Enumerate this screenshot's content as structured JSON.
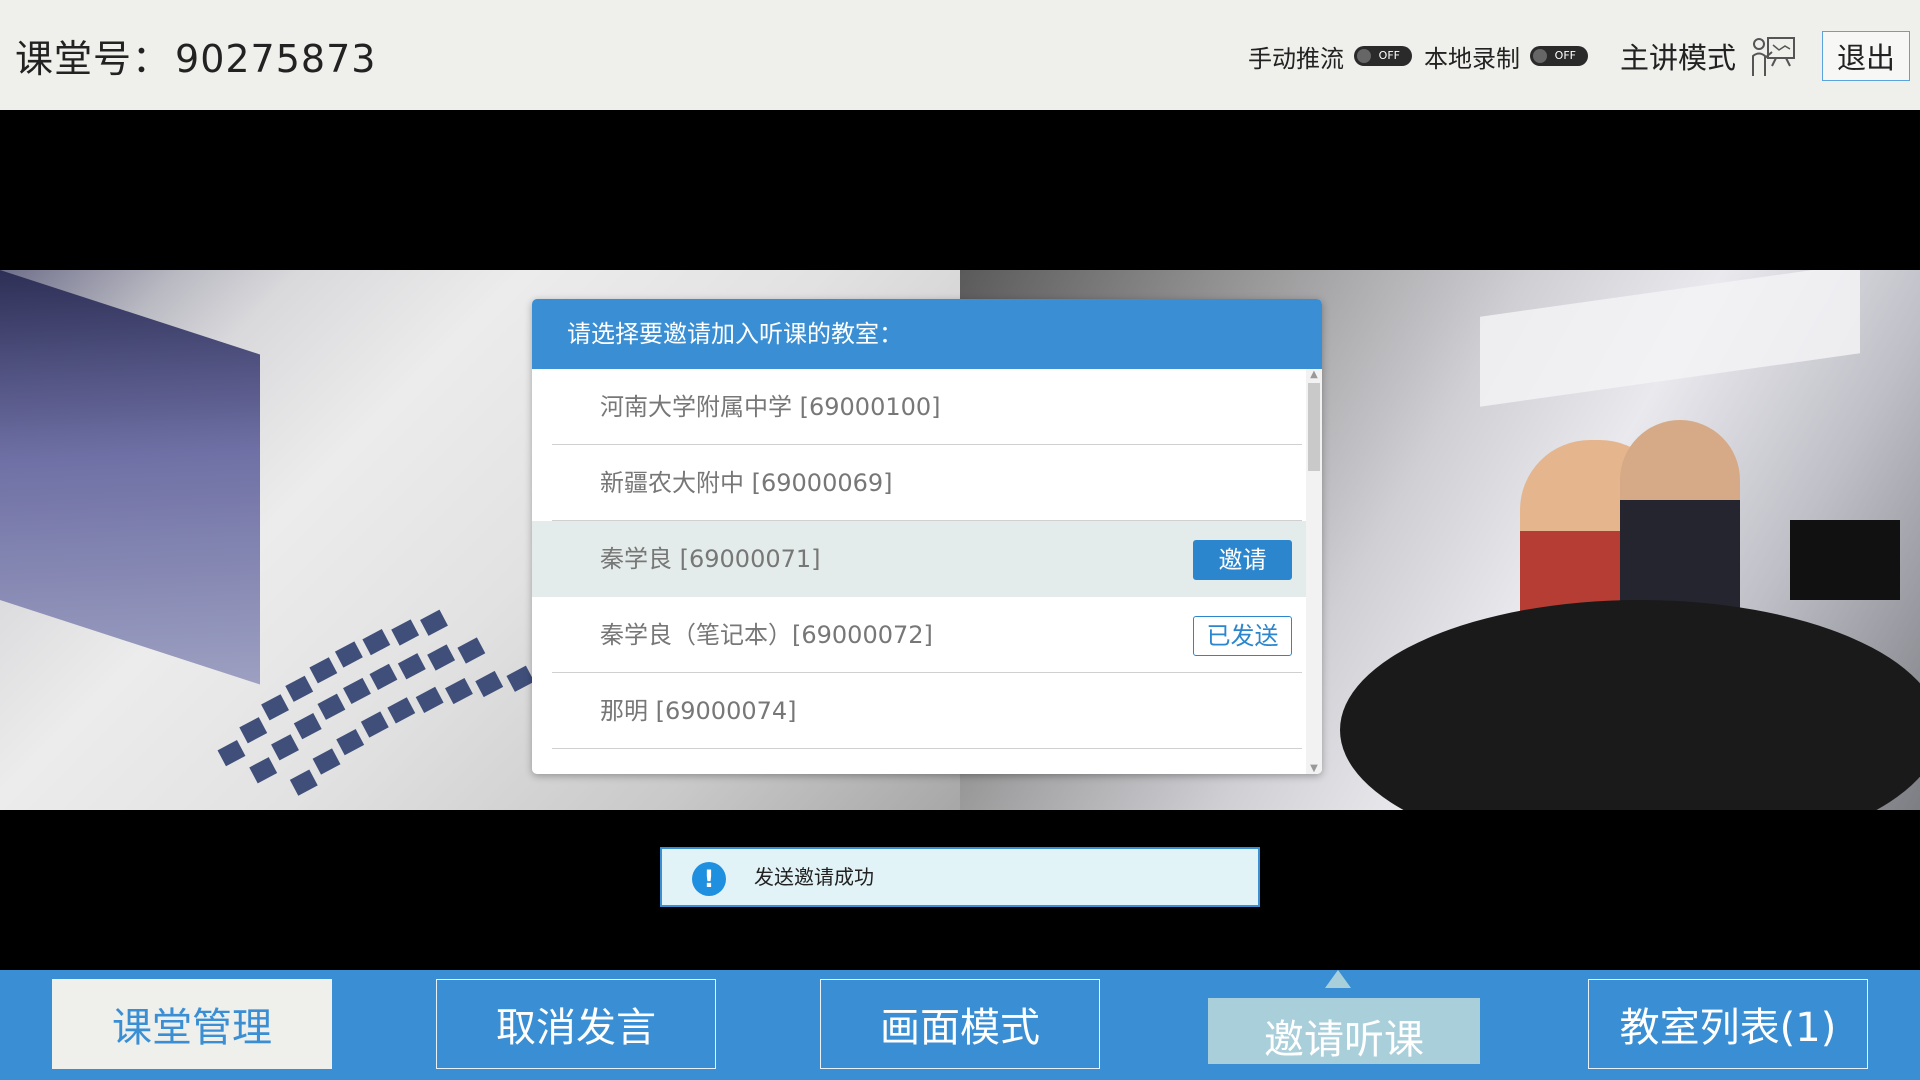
{
  "header": {
    "room_label": "课堂号：",
    "room_number": "90275873",
    "manual_push_label": "手动推流",
    "manual_push_state": "OFF",
    "local_record_label": "本地录制",
    "local_record_state": "OFF",
    "mode_label": "主讲模式",
    "exit_label": "退出"
  },
  "invite_dialog": {
    "title": "请选择要邀请加入听课的教室：",
    "rooms": [
      {
        "name": "河南大学附属中学 [69000100]",
        "action": ""
      },
      {
        "name": "新疆农大附中 [69000069]",
        "action": ""
      },
      {
        "name": "秦学良 [69000071]",
        "action": "邀请"
      },
      {
        "name": "秦学良（笔记本）[69000072]",
        "action": "已发送"
      },
      {
        "name": "那明 [69000074]",
        "action": ""
      }
    ]
  },
  "toast": {
    "icon": "!",
    "message": "发送邀请成功"
  },
  "bottom_bar": {
    "buttons": [
      {
        "label": "课堂管理",
        "state": "active"
      },
      {
        "label": "取消发言",
        "state": "normal"
      },
      {
        "label": "画面模式",
        "state": "normal"
      },
      {
        "label": "邀请听课",
        "state": "selected"
      },
      {
        "label": "教室列表(1)",
        "state": "normal"
      }
    ]
  },
  "colors": {
    "primary_blue": "#3a8fd4",
    "topbar_bg": "#efefeb",
    "selected_row_bg": "#e3ecea",
    "toast_bg": "#e2f3f7"
  },
  "icons": {
    "presenter": "presenter-icon",
    "toast": "info-icon"
  }
}
